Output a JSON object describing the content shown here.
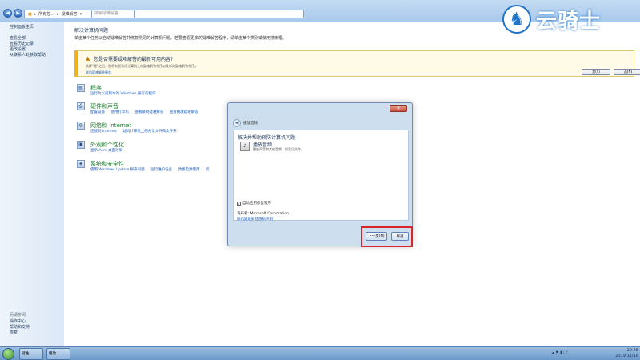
{
  "window": {
    "address": [
      "所有控...",
      "疑难解答"
    ],
    "search_placeholder": "搜索疑难解答"
  },
  "logo": {
    "text": "云骑士"
  },
  "sidebar": {
    "home": "控制面板主页",
    "items": [
      "查看全部",
      "查看历史记录",
      "更改设置",
      "从联系人处获取帮助"
    ],
    "also_label": "另请参阅",
    "see_also": [
      "操作中心",
      "帮助和支持",
      "恢复"
    ]
  },
  "main": {
    "title": "解决计算机问题",
    "description": "单击某个任务以自动疑难解答并修复常见的计算机问题。若要查看更多的疑难解答程序，请单击某个类别或使用搜索框。"
  },
  "banner": {
    "title": "您是否需要疑难解答的最新可用内容?",
    "description": "选择“是”之后，您将有权访问计算机上的疑难解答程序以及新的疑难解答程序。",
    "link": "联机疑难解答服务",
    "yes": "是(Y)",
    "no": "否(N)"
  },
  "categories": [
    {
      "title": "程序",
      "links": [
        "运行为以前版本的 Windows 编写的程序"
      ]
    },
    {
      "title": "硬件和声音",
      "links": [
        "配置设备",
        "使用打印机",
        "查看录制疑难解答",
        "查看播放疑难解答"
      ]
    },
    {
      "title": "网络和 Internet",
      "links": [
        "连接到 Internet",
        "访问计算机上的共享文件和文件夹"
      ]
    },
    {
      "title": "外观和个性化",
      "links": [
        "显示 Aero 桌面效果"
      ]
    },
    {
      "title": "系统和安全性",
      "links": [
        "使用 Windows Update 解决问题",
        "运行维护任务",
        "改善电源使用",
        "检"
      ]
    }
  ],
  "dialog": {
    "name": "播放音频",
    "heading": "解决并帮助预防计算机问题",
    "task_title": "播放音频",
    "task_desc": "播放声音和其他音频，如音乐文件。",
    "auto_repair": "自动应用修复程序",
    "publisher": "发布者:  Microsoft Corporation",
    "privacy": "联机疑难解答隐私声明",
    "next": "下一步(N)",
    "cancel": "取消"
  },
  "taskbar": {
    "buttons": [
      "疑难...",
      "播放..."
    ],
    "time": "20:28",
    "date": "2019/11/18"
  }
}
